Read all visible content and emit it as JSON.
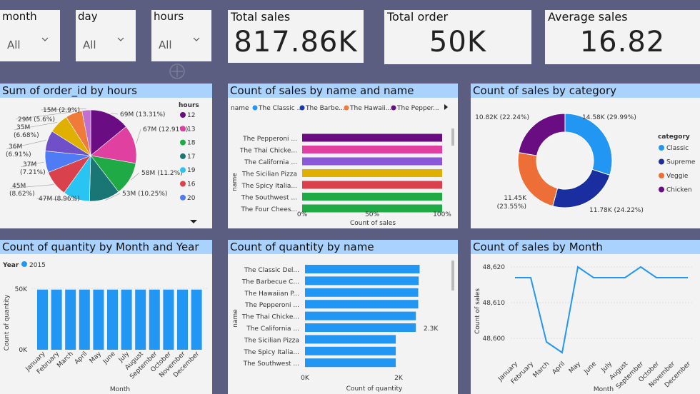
{
  "slicers": [
    {
      "label": "month",
      "value": "All"
    },
    {
      "label": "day",
      "value": "All"
    },
    {
      "label": "hours",
      "value": "All"
    }
  ],
  "kpis": [
    {
      "title": "Total sales",
      "value": "817.86K"
    },
    {
      "title": "Total order",
      "value": "50K"
    },
    {
      "title": "Average sales",
      "value": "16.82"
    }
  ],
  "colors": {
    "background": "#5b5e80",
    "header": "#a9d2ff",
    "blue": "#2196f3"
  },
  "charts": {
    "pie_hours": {
      "title": "Sum of order_id by hours",
      "legend_title": "hours",
      "legend": [
        "12",
        "13",
        "18",
        "17",
        "19",
        "16",
        "20"
      ],
      "slices": [
        {
          "label": "69M (13.31%)",
          "value": 13.31,
          "color": "#6a0d83"
        },
        {
          "label": "67M (12.91%)",
          "value": 12.91,
          "color": "#e040a0"
        },
        {
          "label": "58M (11.2%)",
          "value": 11.2,
          "color": "#1faa45"
        },
        {
          "label": "53M (10.25%)",
          "value": 10.25,
          "color": "#1a7575"
        },
        {
          "label": "47M (8.96%)",
          "value": 8.96,
          "color": "#29c4f2"
        },
        {
          "label": "45M (8.62%)",
          "value": 8.62,
          "color": "#d9424d"
        },
        {
          "label": "37M (7.21%)",
          "value": 7.21,
          "color": "#4f7cf5"
        },
        {
          "label": "36M (6.91%)",
          "value": 6.91,
          "color": "#7050c8"
        },
        {
          "label": "35M (6.68%)",
          "value": 6.68,
          "color": "#e0b000"
        },
        {
          "label": "29M (5.6%)",
          "value": 5.6,
          "color": "#f07a3a"
        },
        {
          "label": "15M (2.9%)",
          "value": 2.9,
          "color": "#c070d0"
        }
      ]
    },
    "bar_name_name": {
      "title": "Count of sales by name and name",
      "legend_label": "name",
      "legend": [
        {
          "name": "The Classic ...",
          "color": "#2196f3"
        },
        {
          "name": "The Barbe...",
          "color": "#1a3aa8"
        },
        {
          "name": "The Hawaii...",
          "color": "#f07a3a"
        },
        {
          "name": "The Pepper...",
          "color": "#6a0d83"
        }
      ],
      "categories": [
        "The Pepperoni ...",
        "The Thai Chicke...",
        "The California ...",
        "The Sicilian Pizza",
        "The Spicy Italia...",
        "The Southwest ...",
        "The Four Chees..."
      ],
      "bar_colors": [
        "#6a0d83",
        "#e040a0",
        "#8a57d8",
        "#e0b000",
        "#d9424d",
        "#1faa45",
        "#1faa45"
      ],
      "values": [
        100,
        100,
        100,
        100,
        100,
        100,
        100
      ],
      "ticks": [
        "0%",
        "50%",
        "100%"
      ],
      "xlabel": "Count of sales",
      "ylabel": "name"
    },
    "donut_category": {
      "title": "Count of sales by category",
      "legend_title": "category",
      "slices": [
        {
          "name": "Classic",
          "label": "14.58K (29.99%)",
          "value": 29.99,
          "color": "#2196f3"
        },
        {
          "name": "Supreme",
          "label": "11.78K (24.22%)",
          "value": 24.22,
          "color": "#1a2ea0"
        },
        {
          "name": "Veggie",
          "label": "11.45K (23.55%)",
          "value": 23.55,
          "color": "#ee6e38"
        },
        {
          "name": "Chicken",
          "label": "10.82K (22.24%)",
          "value": 22.24,
          "color": "#6a0d83"
        }
      ]
    },
    "col_month_year": {
      "title": "Count of quantity by Month and Year",
      "legend_title": "Year",
      "legend_value": "2015",
      "categories": [
        "January",
        "February",
        "March",
        "April",
        "May",
        "June",
        "July",
        "August",
        "September",
        "October",
        "November",
        "December"
      ],
      "values": [
        49,
        49,
        49,
        49,
        49,
        49,
        49,
        49,
        49,
        49,
        49,
        49
      ],
      "ticks": [
        "50K",
        "0K"
      ],
      "xlabel": "Month",
      "ylabel": "Count of quantity"
    },
    "bar_qty_name": {
      "title": "Count of quantity by name",
      "categories": [
        "The Classic Del...",
        "The Barbecue C...",
        "The Hawaiian P...",
        "The Pepperoni ...",
        "The Thai Chicke...",
        "The California ...",
        "The Sicilian Pizza",
        "The Spicy Italia...",
        "The Southwest ..."
      ],
      "values": [
        2.45,
        2.43,
        2.42,
        2.42,
        2.37,
        2.37,
        1.94,
        1.94,
        1.94
      ],
      "data_label": "2.3K",
      "ticks": [
        "0K",
        "2K"
      ],
      "xlabel": "Count of quantity",
      "ylabel": "name"
    },
    "line_month": {
      "title": "Count of sales by Month",
      "categories": [
        "January",
        "February",
        "March",
        "April",
        "May",
        "June",
        "July",
        "August",
        "September",
        "October",
        "November",
        "December"
      ],
      "values": [
        48617,
        48617,
        48599,
        48596,
        48620,
        48617,
        48617,
        48617,
        48620,
        48617,
        48617,
        48617
      ],
      "yticks": [
        "48,620",
        "48,610",
        "48,600"
      ],
      "ylim": [
        48594,
        48622
      ],
      "xlabel": "Month",
      "ylabel": "Count of sales"
    }
  }
}
